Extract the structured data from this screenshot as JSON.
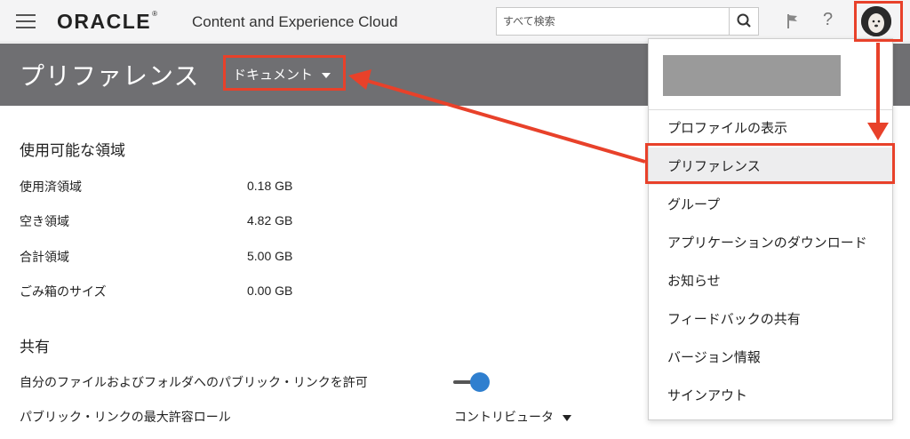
{
  "header": {
    "logo": "ORACLE",
    "logo_mark": "®",
    "product": "Content and Experience Cloud",
    "search_placeholder": "すべて検索"
  },
  "page": {
    "title": "プリファレンス",
    "dropdown": "ドキュメント"
  },
  "storage": {
    "title": "使用可能な領域",
    "rows": [
      {
        "label": "使用済領域",
        "value": "0.18 GB"
      },
      {
        "label": "空き領域",
        "value": "4.82 GB"
      },
      {
        "label": "合計領域",
        "value": "5.00 GB"
      },
      {
        "label": "ごみ箱のサイズ",
        "value": "0.00 GB"
      }
    ]
  },
  "sharing": {
    "title": "共有",
    "public_link_label": "自分のファイルおよびフォルダへのパブリック・リンクを許可",
    "public_link_enabled": true,
    "max_role_label": "パブリック・リンクの最大許容ロール",
    "max_role_value": "コントリビュータ"
  },
  "user_menu": {
    "items": [
      "プロファイルの表示",
      "プリファレンス",
      "グループ",
      "アプリケーションのダウンロード",
      "お知らせ",
      "フィードバックの共有",
      "バージョン情報",
      "サインアウト"
    ],
    "active_index": 1
  },
  "colors": {
    "annotation": "#e8412a",
    "title_bar": "#6f6f72",
    "toggle": "#2f7fcf"
  }
}
